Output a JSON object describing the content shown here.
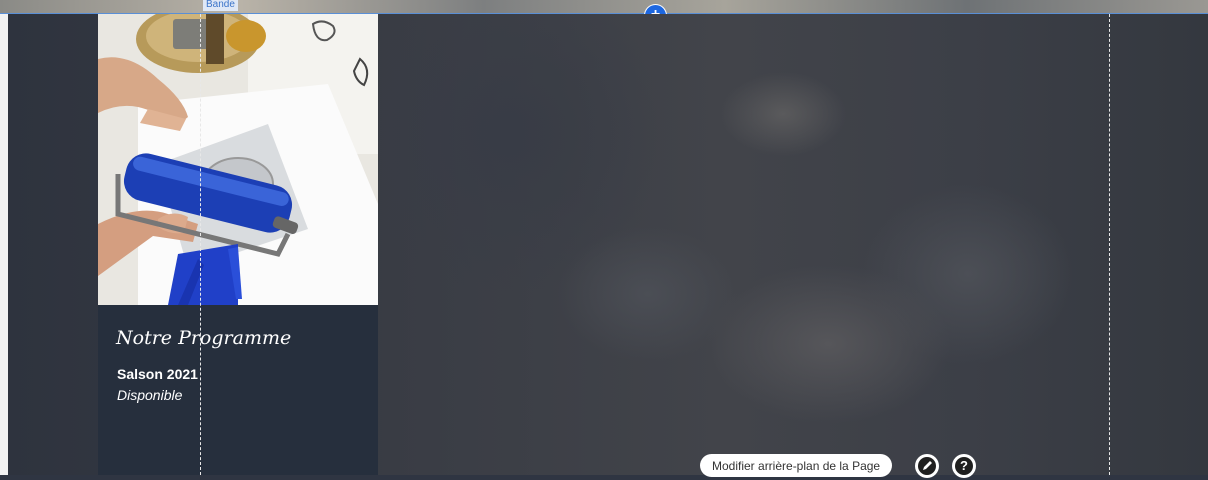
{
  "editor": {
    "band_label": "Bande",
    "add_section_symbol": "+"
  },
  "card": {
    "title": "Notre Programme",
    "season": "Salson 2021",
    "status": "Disponible"
  },
  "bottom_bar": {
    "modify_background_label": "Modifier arrière-plan de la Page",
    "edit_icon": "pencil-icon",
    "help_icon": "question-icon",
    "help_symbol": "?"
  },
  "colors": {
    "card_background": "#262f3d",
    "page_background": "#2f3542",
    "accent_blue": "#1d67e0",
    "roller_blue": "#1c3fb5"
  }
}
